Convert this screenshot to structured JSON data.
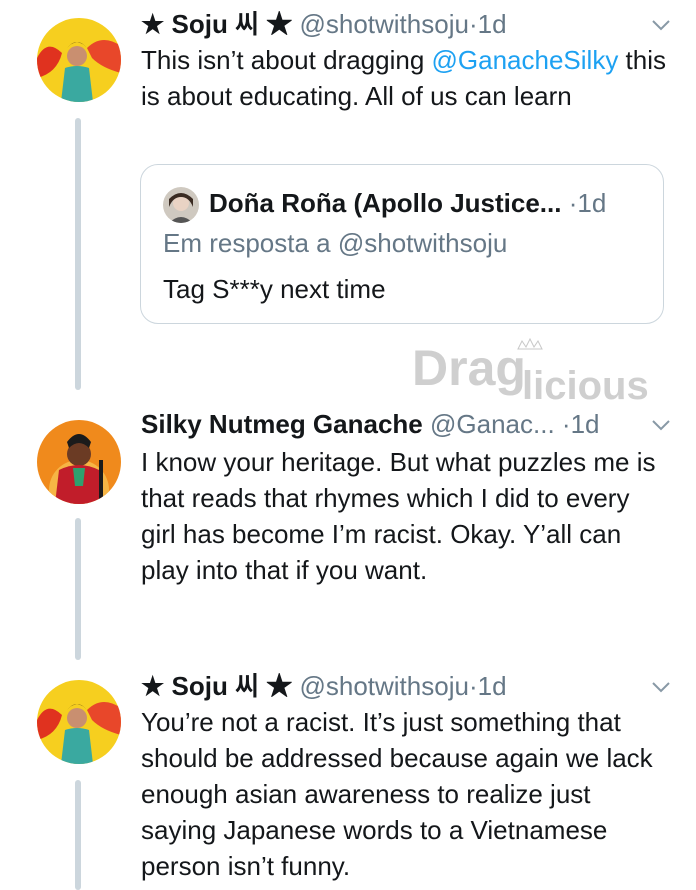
{
  "tweets": [
    {
      "name": "★ Soju 씨 ★",
      "handle": "@shotwithsoju",
      "time": "1d",
      "text_before": "This isn’t about dragging ",
      "mention": "@GanacheSilky",
      "text_after": " this is about educating. All of us can learn",
      "quote": {
        "name": "Doña Roña (Apollo Justice...",
        "time": "1d",
        "reply_to": "Em resposta a @shotwithsoju",
        "text": "Tag S***y next time"
      }
    },
    {
      "name": "Silky Nutmeg Ganache",
      "handle": "@Ganac...",
      "time": "1d",
      "text": "I know your heritage. But what puzzles me is that reads that rhymes which I did to every girl has become I’m racist. Okay. Y’all can play into that if you want."
    },
    {
      "name": "★ Soju 씨 ★",
      "handle": "@shotwithsoju",
      "time": "1d",
      "text": "You’re not a racist. It’s just something that should be addressed because again we lack enough asian awareness to realize just saying Japanese words to a Vietnamese person isn’t funny."
    }
  ],
  "watermark": "DragLicious",
  "separator": "·",
  "colors": {
    "link": "#1da1f2",
    "muted": "#657786",
    "thread": "#ccd6dd",
    "border": "#ccd6dd"
  },
  "icons": {
    "chevron": "chevron-down-icon",
    "avatar": "avatar"
  }
}
